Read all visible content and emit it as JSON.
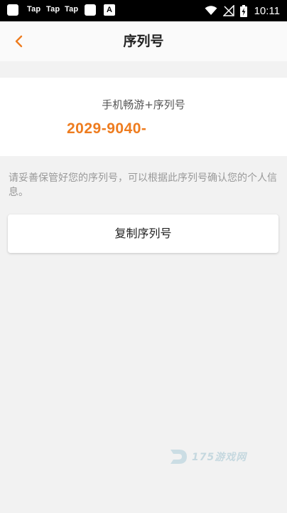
{
  "status_bar": {
    "notifications": [
      "Tap",
      "Tap",
      "Tap"
    ],
    "time": "10:11"
  },
  "header": {
    "title": "序列号"
  },
  "card": {
    "label": "手机畅游+序列号",
    "serial": "2029-9040-"
  },
  "tip": "请妥善保管好您的序列号，可以根据此序列号确认您的个人信息。",
  "copy_button": "复制序列号",
  "watermark": "175游戏网",
  "colors": {
    "accent": "#ee7c1f",
    "background": "#f2f2f2",
    "card": "#ffffff"
  }
}
